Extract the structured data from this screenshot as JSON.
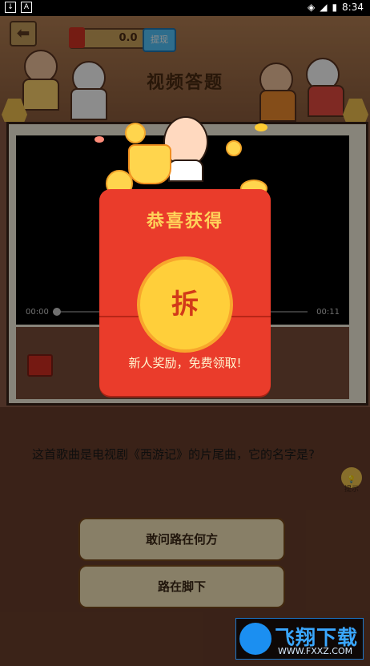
{
  "status_bar": {
    "left_icons": [
      "download-icon",
      "a-icon"
    ],
    "time": "8:34",
    "right_icons": [
      "wifi-icon",
      "signal-icon",
      "battery-icon"
    ]
  },
  "header": {
    "back_icon": "back-arrow-icon",
    "money": "0.0",
    "withdraw_label": "提现",
    "title": "视频答题"
  },
  "video": {
    "current_time": "00:00",
    "duration": "00:11",
    "progress": 0
  },
  "question": {
    "text": "这首歌曲是电视剧《西游记》的片尾曲，它的名字是?"
  },
  "hint": {
    "label": "提示",
    "icon": "bulb-icon"
  },
  "options": [
    {
      "label": "敢问路在何方"
    },
    {
      "label": "路在脚下"
    }
  ],
  "popup": {
    "title": "恭喜获得",
    "open_label": "拆",
    "tip": "新人奖励，免费领取!",
    "icons": [
      "coin-icon",
      "trophy-icon",
      "mascot-icon",
      "spark-icon"
    ]
  },
  "watermark": {
    "brand": "飞翔下载",
    "site": "WWW.FXXZ.COM",
    "logo_icon": "brand-logo-icon"
  },
  "colors": {
    "popup_red": "#ea3c2b",
    "coin_gold": "#ffcf3a",
    "title_gold": "#ffd35a",
    "option_bg": "#f7e8bc"
  }
}
